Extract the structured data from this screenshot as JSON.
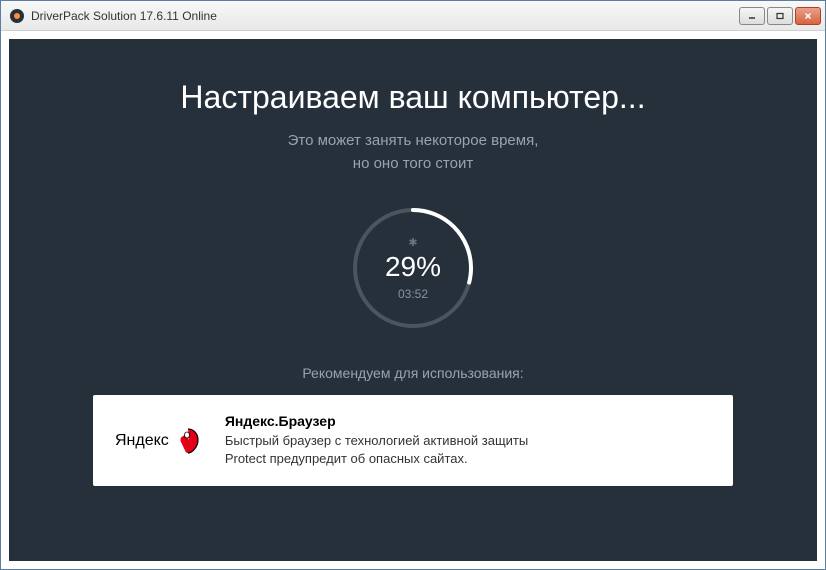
{
  "window": {
    "title": "DriverPack Solution 17.6.11 Online"
  },
  "main": {
    "title": "Настраиваем ваш компьютер...",
    "subtitle_line1": "Это может занять некоторое время,",
    "subtitle_line2": "но оно того стоит"
  },
  "progress": {
    "percent_value": 29,
    "percent_display": "29%",
    "time": "03:52"
  },
  "recommend": {
    "label": "Рекомендуем для использования:",
    "promo": {
      "logo_text": "Яндекс",
      "title": "Яндекс.Браузер",
      "desc_line1": "Быстрый браузер с технологией активной защиты",
      "desc_line2": "Protect предупредит об опасных сайтах."
    }
  }
}
